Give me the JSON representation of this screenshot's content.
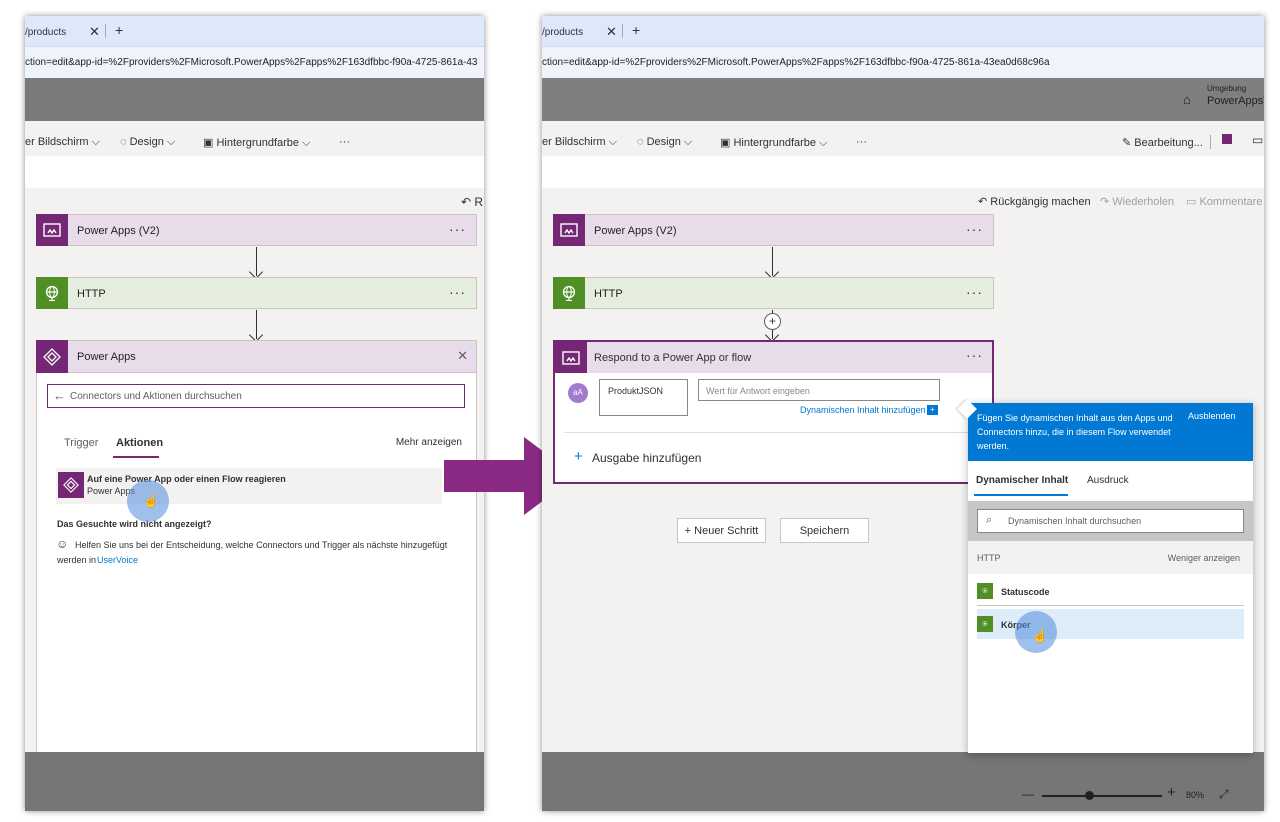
{
  "left": {
    "tab_title": "/products",
    "url": "ction=edit&app-id=%2Fproviders%2FMicrosoft.PowerApps%2Fapps%2F163dfbbc-f90a-4725-861a-43",
    "toolbar": {
      "screen": "er Bildschirm",
      "design": "Design",
      "background": "Hintergrundfarbe",
      "more": "···"
    },
    "undo_short": "R",
    "steps": [
      {
        "title": "Power Apps (V2)",
        "more": "···"
      },
      {
        "title": "HTTP",
        "more": "···"
      },
      {
        "title": "Power Apps"
      }
    ],
    "search_placeholder": "Connectors und Aktionen durchsuchen",
    "tabs": [
      "Trigger",
      "Aktionen"
    ],
    "more_label": "Mehr anzeigen",
    "action": {
      "title": "Auf eine Power App oder einen Flow reagieren",
      "subtitle": "Power Apps"
    },
    "notfound_title": "Das Gesuchte wird nicht angezeigt?",
    "help_text": "Helfen Sie uns bei der Entscheidung, welche Connectors und Trigger als nächste hinzugefügt",
    "help_text2": "werden in",
    "help_link": "UserVoice"
  },
  "right": {
    "tab_title": "/products",
    "url": "ction=edit&app-id=%2Fproviders%2FMicrosoft.PowerApps%2Fapps%2F163dfbbc-f90a-4725-861a-43ea0d68c96a",
    "env_label": "Umgebung",
    "env_value": "PowerAppsTr",
    "toolbar": {
      "screen": "er Bildschirm",
      "design": "Design",
      "background": "Hintergrundfarbe",
      "more": "···",
      "edit": "Bearbeitung..."
    },
    "undo": "Rückgängig machen",
    "redo": "Wiederholen",
    "comments": "Kommentare",
    "steps": [
      {
        "title": "Power Apps (V2)",
        "more": "···"
      },
      {
        "title": "HTTP",
        "more": "···"
      },
      {
        "title": "Respond to a Power App or flow",
        "more": "···"
      }
    ],
    "avatar": "aA",
    "field_name": "ProduktJSON",
    "field_placeholder": "Wert für Antwort eingeben",
    "dynamic_link": "Dynamischen Inhalt hinzufügen",
    "add_output": "Ausgabe hinzufügen",
    "new_step": "+ Neuer Schritt",
    "save": "Speichern",
    "zoom": "80%",
    "dynamic_panel": {
      "info": "Fügen Sie dynamischen Inhalt aus den Apps und Connectors hinzu, die in diesem Flow verwendet werden.",
      "hide": "Ausblenden",
      "tabs": [
        "Dynamischer Inhalt",
        "Ausdruck"
      ],
      "search_placeholder": "Dynamischen Inhalt durchsuchen",
      "group": "HTTP",
      "show_less": "Weniger anzeigen",
      "items": [
        "Statuscode",
        "Körper"
      ]
    }
  },
  "colors": {
    "accent": "#0078d4",
    "purple": "#742774",
    "green": "#4f8f25",
    "arrow": "#8b2a85"
  }
}
